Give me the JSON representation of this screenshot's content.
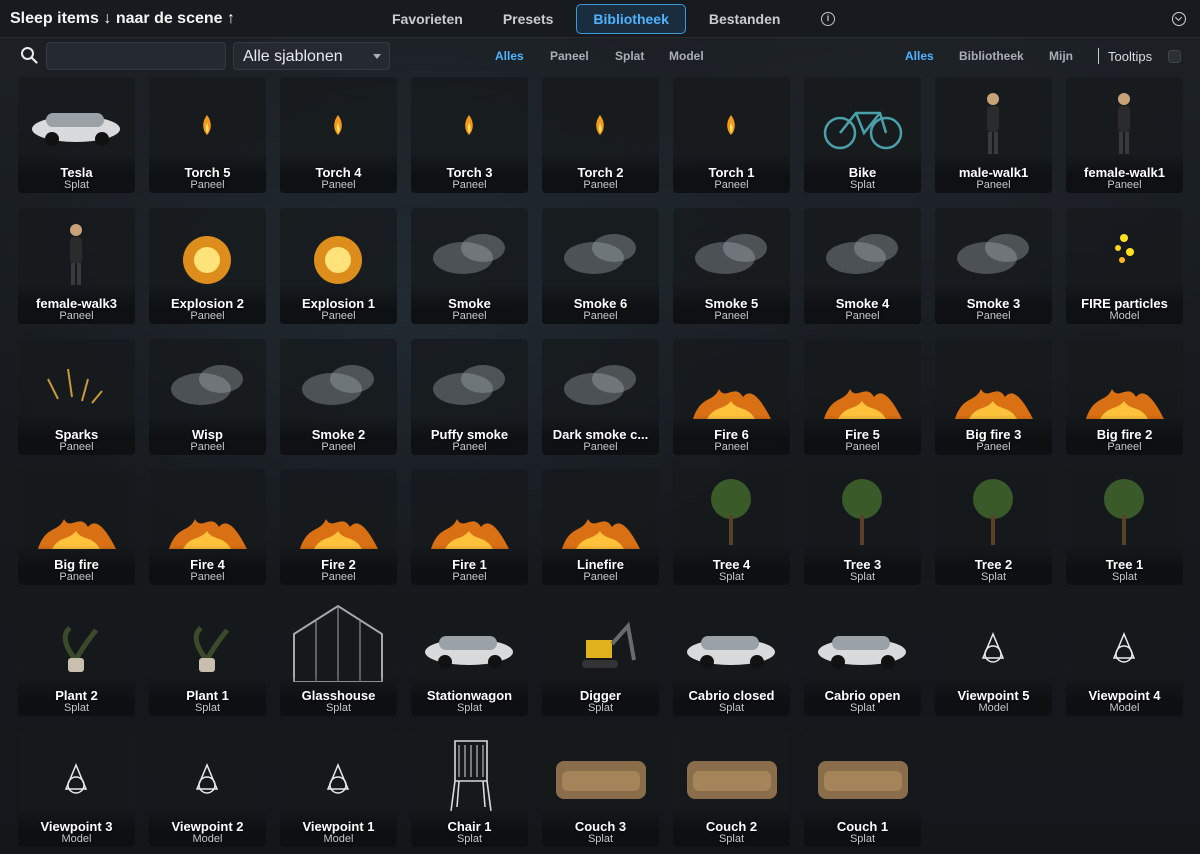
{
  "header": {
    "title": "Sleep items ↓ naar de scene ↑",
    "tabs": [
      {
        "label": "Favorieten",
        "active": false
      },
      {
        "label": "Presets",
        "active": false
      },
      {
        "label": "Bibliotheek",
        "active": true
      },
      {
        "label": "Bestanden",
        "active": false
      }
    ]
  },
  "toolbar": {
    "search": {
      "value": "",
      "placeholder": ""
    },
    "template_select": {
      "value": "Alle sjablonen"
    },
    "type_filters": [
      {
        "label": "Alles",
        "active": true
      },
      {
        "label": "Paneel",
        "active": false
      },
      {
        "label": "Splat",
        "active": false
      },
      {
        "label": "Model",
        "active": false
      }
    ],
    "source_filters": [
      {
        "label": "Alles",
        "active": true
      },
      {
        "label": "Bibliotheek",
        "active": false
      },
      {
        "label": "Mijn",
        "active": false
      }
    ],
    "tooltips_label": "Tooltips",
    "tooltips_enabled": false
  },
  "colors": {
    "accent": "#4fb3ff",
    "card_bg": "#16191c",
    "text": "#ffffff",
    "subtext": "#c6cacd"
  },
  "items": [
    {
      "name": "Tesla",
      "type": "Splat",
      "icon": "car-icon"
    },
    {
      "name": "Torch 5",
      "type": "Paneel",
      "icon": "flame-icon"
    },
    {
      "name": "Torch 4",
      "type": "Paneel",
      "icon": "flame-icon"
    },
    {
      "name": "Torch 3",
      "type": "Paneel",
      "icon": "flame-icon"
    },
    {
      "name": "Torch 2",
      "type": "Paneel",
      "icon": "flame-icon"
    },
    {
      "name": "Torch 1",
      "type": "Paneel",
      "icon": "flame-icon"
    },
    {
      "name": "Bike",
      "type": "Splat",
      "icon": "bike-icon"
    },
    {
      "name": "male-walk1",
      "type": "Paneel",
      "icon": "person-icon"
    },
    {
      "name": "female-walk1",
      "type": "Paneel",
      "icon": "person-icon"
    },
    {
      "name": "female-walk3",
      "type": "Paneel",
      "icon": "person-icon"
    },
    {
      "name": "Explosion 2",
      "type": "Paneel",
      "icon": "explosion-icon"
    },
    {
      "name": "Explosion 1",
      "type": "Paneel",
      "icon": "explosion-icon"
    },
    {
      "name": "Smoke",
      "type": "Paneel",
      "icon": "smoke-icon"
    },
    {
      "name": "Smoke 6",
      "type": "Paneel",
      "icon": "smoke-icon"
    },
    {
      "name": "Smoke 5",
      "type": "Paneel",
      "icon": "smoke-icon"
    },
    {
      "name": "Smoke 4",
      "type": "Paneel",
      "icon": "smoke-icon"
    },
    {
      "name": "Smoke 3",
      "type": "Paneel",
      "icon": "smoke-icon"
    },
    {
      "name": "FIRE particles",
      "type": "Model",
      "icon": "particles-icon"
    },
    {
      "name": "Sparks",
      "type": "Paneel",
      "icon": "sparks-icon"
    },
    {
      "name": "Wisp",
      "type": "Paneel",
      "icon": "smoke-icon"
    },
    {
      "name": "Smoke 2",
      "type": "Paneel",
      "icon": "smoke-icon"
    },
    {
      "name": "Puffy smoke",
      "type": "Paneel",
      "icon": "smoke-icon"
    },
    {
      "name": "Dark smoke c...",
      "type": "Paneel",
      "icon": "smoke-icon"
    },
    {
      "name": "Fire 6",
      "type": "Paneel",
      "icon": "fire-icon"
    },
    {
      "name": "Fire 5",
      "type": "Paneel",
      "icon": "fire-icon"
    },
    {
      "name": "Big fire 3",
      "type": "Paneel",
      "icon": "fire-icon"
    },
    {
      "name": "Big fire 2",
      "type": "Paneel",
      "icon": "fire-icon"
    },
    {
      "name": "Big fire",
      "type": "Paneel",
      "icon": "fire-icon"
    },
    {
      "name": "Fire 4",
      "type": "Paneel",
      "icon": "fire-icon"
    },
    {
      "name": "Fire 2",
      "type": "Paneel",
      "icon": "fire-icon"
    },
    {
      "name": "Fire 1",
      "type": "Paneel",
      "icon": "fire-icon"
    },
    {
      "name": "Linefire",
      "type": "Paneel",
      "icon": "fire-icon"
    },
    {
      "name": "Tree 4",
      "type": "Splat",
      "icon": "tree-icon"
    },
    {
      "name": "Tree 3",
      "type": "Splat",
      "icon": "tree-icon"
    },
    {
      "name": "Tree 2",
      "type": "Splat",
      "icon": "tree-icon"
    },
    {
      "name": "Tree 1",
      "type": "Splat",
      "icon": "tree-icon"
    },
    {
      "name": "Plant 2",
      "type": "Splat",
      "icon": "plant-icon"
    },
    {
      "name": "Plant 1",
      "type": "Splat",
      "icon": "plant-icon"
    },
    {
      "name": "Glasshouse",
      "type": "Splat",
      "icon": "glasshouse-icon"
    },
    {
      "name": "Stationwagon",
      "type": "Splat",
      "icon": "car-icon"
    },
    {
      "name": "Digger",
      "type": "Splat",
      "icon": "digger-icon"
    },
    {
      "name": "Cabrio closed",
      "type": "Splat",
      "icon": "car-icon"
    },
    {
      "name": "Cabrio open",
      "type": "Splat",
      "icon": "car-icon"
    },
    {
      "name": "Viewpoint 5",
      "type": "Model",
      "icon": "viewpoint-icon"
    },
    {
      "name": "Viewpoint 4",
      "type": "Model",
      "icon": "viewpoint-icon"
    },
    {
      "name": "Viewpoint 3",
      "type": "Model",
      "icon": "viewpoint-icon"
    },
    {
      "name": "Viewpoint 2",
      "type": "Model",
      "icon": "viewpoint-icon"
    },
    {
      "name": "Viewpoint 1",
      "type": "Model",
      "icon": "viewpoint-icon"
    },
    {
      "name": "Chair 1",
      "type": "Splat",
      "icon": "chair-icon"
    },
    {
      "name": "Couch 3",
      "type": "Splat",
      "icon": "couch-icon"
    },
    {
      "name": "Couch 2",
      "type": "Splat",
      "icon": "couch-icon"
    },
    {
      "name": "Couch 1",
      "type": "Splat",
      "icon": "couch-icon"
    }
  ]
}
